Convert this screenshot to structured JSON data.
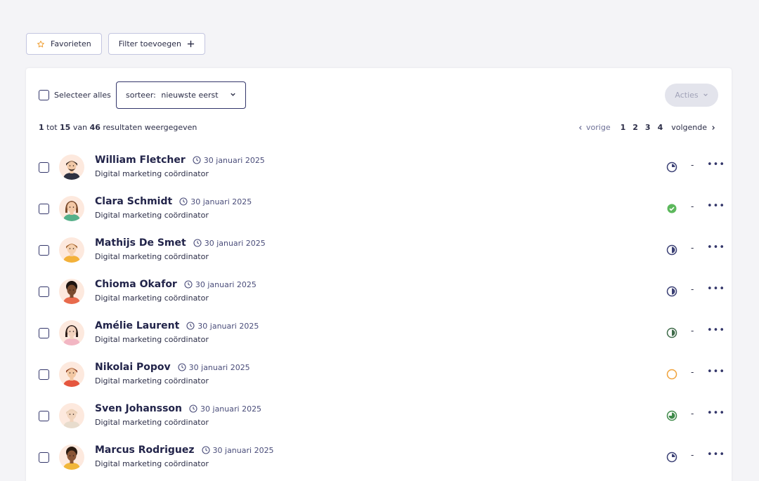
{
  "toolbar": {
    "favorites_label": "Favorieten",
    "add_filter_label": "Filter toevoegen"
  },
  "list_controls": {
    "select_all_label": "Selecteer alles",
    "sort_prefix": "sorteer:",
    "sort_value": "nieuwste eerst",
    "actions_label": "Acties"
  },
  "results": {
    "from": "1",
    "tot": "tot",
    "to": "15",
    "van": "van",
    "total": "46",
    "suffix": "resultaten weergegeven"
  },
  "pagination": {
    "prev_label": "vorige",
    "pages": [
      "1",
      "2",
      "3",
      "4"
    ],
    "next_label": "volgende"
  },
  "candidates": [
    {
      "name": "William Fletcher",
      "date": "30 januari 2025",
      "role": "Digital marketing coördinator",
      "status": "quarter-pending",
      "dash": "-",
      "status_color": "#3a3f74"
    },
    {
      "name": "Clara Schmidt",
      "date": "30 januari 2025",
      "role": "Digital marketing coördinator",
      "status": "complete",
      "dash": "-",
      "status_color": "#5cb85c"
    },
    {
      "name": "Mathijs De Smet",
      "date": "30 januari 2025",
      "role": "Digital marketing coördinator",
      "status": "half",
      "dash": "-",
      "status_color": "#3a3f74"
    },
    {
      "name": "Chioma Okafor",
      "date": "30 januari 2025",
      "role": "Digital marketing coördinator",
      "status": "half",
      "dash": "-",
      "status_color": "#3a3f74"
    },
    {
      "name": "Amélie Laurent",
      "date": "30 januari 2025",
      "role": "Digital marketing coördinator",
      "status": "half-green",
      "dash": "-",
      "status_color": "#3f6b4a"
    },
    {
      "name": "Nikolai Popov",
      "date": "30 januari 2025",
      "role": "Digital marketing coördinator",
      "status": "empty",
      "dash": "-",
      "status_color": "#f0a23a"
    },
    {
      "name": "Sven Johansson",
      "date": "30 januari 2025",
      "role": "Digital marketing coördinator",
      "status": "three-quarter-green",
      "dash": "-",
      "status_color": "#3f8a4a"
    },
    {
      "name": "Marcus Rodriguez",
      "date": "30 januari 2025",
      "role": "Digital marketing coördinator",
      "status": "quarter-pending",
      "dash": "-",
      "status_color": "#3a3f74"
    }
  ],
  "icons": {
    "favorites": "star-icon",
    "add_filter": "plus-icon",
    "sort": "chevron-down-icon",
    "actions": "chevron-down-icon",
    "date": "clock-icon",
    "more": "more-horizontal-icon"
  },
  "colors": {
    "star": "#f0a23a",
    "accent": "#33366a",
    "complete": "#5cb85c"
  }
}
